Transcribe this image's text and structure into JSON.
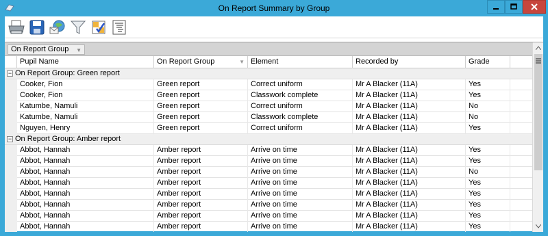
{
  "window": {
    "title": "On Report Summary by Group"
  },
  "toolbar": {
    "buttons": [
      {
        "name": "print-button",
        "icon": "printer-icon"
      },
      {
        "name": "save-button",
        "icon": "floppy-disk-icon"
      },
      {
        "name": "email-button",
        "icon": "email-globe-icon"
      },
      {
        "name": "filter-button",
        "icon": "funnel-icon"
      },
      {
        "name": "select-columns-button",
        "icon": "checklist-icon"
      },
      {
        "name": "field-list-button",
        "icon": "list-icon"
      }
    ]
  },
  "grid": {
    "group_by_chip": "On Report Group",
    "columns": [
      "Pupil Name",
      "On Report Group",
      "Element",
      "Recorded by",
      "Grade"
    ],
    "groups": [
      {
        "label": "On Report Group: Green report",
        "rows": [
          [
            "Cooker, Fion",
            "Green report",
            "Correct uniform",
            "Mr A Blacker (11A)",
            "Yes"
          ],
          [
            "Cooker, Fion",
            "Green report",
            "Classwork complete",
            "Mr A Blacker (11A)",
            "Yes"
          ],
          [
            "Katumbe, Namuli",
            "Green report",
            "Correct uniform",
            "Mr A Blacker (11A)",
            "No"
          ],
          [
            "Katumbe, Namuli",
            "Green report",
            "Classwork complete",
            "Mr A Blacker (11A)",
            "No"
          ],
          [
            "Nguyen, Henry",
            "Green report",
            "Correct uniform",
            "Mr A Blacker (11A)",
            "Yes"
          ]
        ]
      },
      {
        "label": "On Report Group: Amber report",
        "rows": [
          [
            "Abbot, Hannah",
            "Amber report",
            "Arrive on time",
            "Mr A Blacker (11A)",
            "Yes"
          ],
          [
            "Abbot, Hannah",
            "Amber report",
            "Arrive on time",
            "Mr A Blacker (11A)",
            "Yes"
          ],
          [
            "Abbot, Hannah",
            "Amber report",
            "Arrive on time",
            "Mr A Blacker (11A)",
            "No"
          ],
          [
            "Abbot, Hannah",
            "Amber report",
            "Arrive on time",
            "Mr A Blacker (11A)",
            "Yes"
          ],
          [
            "Abbot, Hannah",
            "Amber report",
            "Arrive on time",
            "Mr A Blacker (11A)",
            "Yes"
          ],
          [
            "Abbot, Hannah",
            "Amber report",
            "Arrive on time",
            "Mr A Blacker (11A)",
            "Yes"
          ],
          [
            "Abbot, Hannah",
            "Amber report",
            "Arrive on time",
            "Mr A Blacker (11A)",
            "Yes"
          ],
          [
            "Abbot, Hannah",
            "Amber report",
            "Arrive on time",
            "Mr A Blacker (11A)",
            "Yes"
          ]
        ]
      }
    ]
  },
  "colors": {
    "title_bar": "#3ba9d8",
    "close_button": "#c7463d",
    "group_panel": "#d4d4d4",
    "group_row": "#efefef"
  }
}
